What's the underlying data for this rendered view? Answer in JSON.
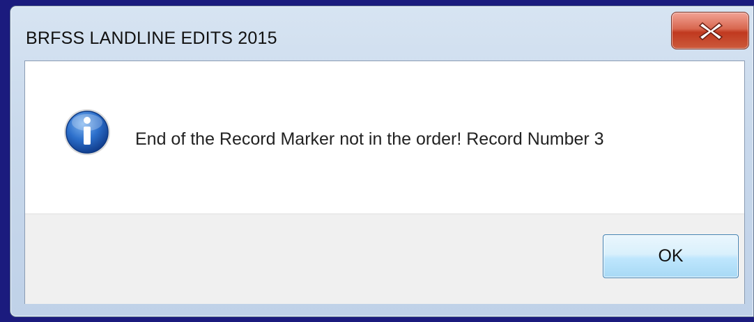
{
  "dialog": {
    "title": "BRFSS LANDLINE EDITS 2015",
    "message": "End of the Record Marker not in the order! Record Number 3",
    "icon": "info-icon",
    "close_icon": "close-icon",
    "ok_label": "OK"
  },
  "colors": {
    "background": "#1b1b7e",
    "close_button": "#c0391f",
    "ok_button_border": "#3c7fb1",
    "info_icon": "#1f5fb8"
  }
}
